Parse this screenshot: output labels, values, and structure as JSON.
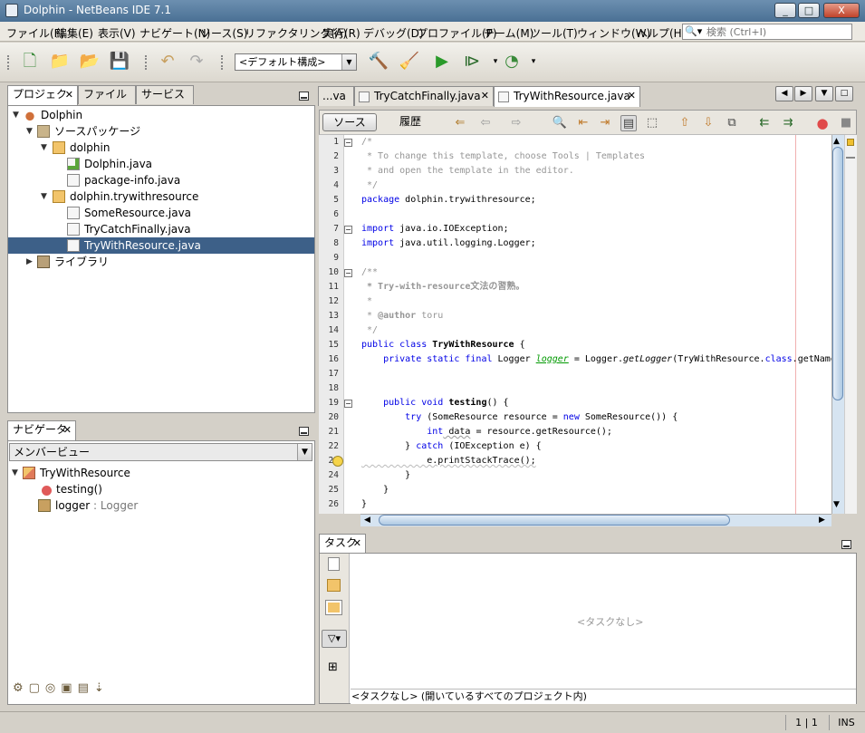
{
  "window": {
    "title": "Dolphin - NetBeans IDE 7.1",
    "buttons": [
      "_",
      "□",
      "X"
    ]
  },
  "menubar": {
    "items": [
      "ファイル(F)",
      "編集(E)",
      "表示(V)",
      "ナビゲート(N)",
      "ソース(S)",
      "リファクタリング(A)",
      "実行(R)",
      "デバッグ(D)",
      "プロファイル(P)",
      "チーム(M)",
      "ツール(T)",
      "ウィンドウ(W)",
      "ヘルプ(H)"
    ],
    "search_placeholder": "検索 (Ctrl+I)"
  },
  "toolbar": {
    "config": "<デフォルト構成>"
  },
  "project_panel": {
    "tabs": [
      "プロジェクト",
      "ファイル",
      "サービス"
    ],
    "tree": [
      {
        "label": "Dolphin",
        "icon": "project-icon"
      },
      {
        "label": "ソースパッケージ",
        "icon": "source-folder-icon"
      },
      {
        "label": "dolphin",
        "icon": "package-icon"
      },
      {
        "label": "Dolphin.java",
        "icon": "main-java-file-icon"
      },
      {
        "label": "package-info.java",
        "icon": "java-file-icon"
      },
      {
        "label": "dolphin.trywithresource",
        "icon": "package-icon"
      },
      {
        "label": "SomeResource.java",
        "icon": "java-file-icon"
      },
      {
        "label": "TryCatchFinally.java",
        "icon": "java-file-icon"
      },
      {
        "label": "TryWithResource.java",
        "icon": "java-file-icon"
      },
      {
        "label": "ライブラリ",
        "icon": "library-icon"
      }
    ]
  },
  "navigator": {
    "tab": "ナビゲータ",
    "view": "メンバービュー",
    "class_name": "TryWithResource",
    "members": [
      {
        "name": "testing()",
        "type": ""
      },
      {
        "name": "logger",
        "type": " : Logger"
      }
    ]
  },
  "editor": {
    "tabs": [
      "...va",
      "TryCatchFinally.java",
      "TryWithResource.java"
    ],
    "source_tab": "ソース",
    "history_tab": "履歴",
    "line_numbers": [
      "1",
      "2",
      "3",
      "4",
      "5",
      "6",
      "7",
      "8",
      "9",
      "10",
      "11",
      "12",
      "13",
      "14",
      "15",
      "16",
      "17",
      "18",
      "19",
      "20",
      "21",
      "22",
      "23",
      "24",
      "25",
      "26"
    ],
    "code": {
      "l1": "/*",
      "l2": " * To change this template, choose Tools | Templates",
      "l3": " * and open the template in the editor.",
      "l4": " */",
      "l5a": "package",
      "l5b": " dolphin.trywithresource;",
      "l7a": "import",
      "l7b": " java.io.IOException;",
      "l8a": "import",
      "l8b": " java.util.logging.Logger;",
      "l10": "/**",
      "l11": " * Try-with-resource文法の習熟。",
      "l12": " *",
      "l13a": " * ",
      "l13b": "@author",
      "l13c": " toru",
      "l14": " */",
      "l15a": "public class",
      "l15b": " TryWithResource",
      "l15c": " {",
      "l16a": "    private static final",
      "l16b": " Logger ",
      "l16c": "logger",
      "l16d": " = Logger.",
      "l16e": "getLogger",
      "l16f": "(TryWithResource.",
      "l16g": "class",
      "l16h": ".getName",
      "l19a": "    public void",
      "l19b": " testing",
      "l19c": "() {",
      "l20a": "        try",
      "l20b": " (SomeResource resource = ",
      "l20c": "new",
      "l20d": " SomeResource()) {",
      "l21a": "            int",
      "l21b": " data",
      "l21c": " = resource.getResource();",
      "l22a": "        } ",
      "l22b": "catch",
      "l22c": " (IOException e) {",
      "l23": "            e.printStackTrace();",
      "l24": "        }",
      "l25": "    }",
      "l26": "}"
    }
  },
  "tasks": {
    "tab": "タスク",
    "empty": "<タスクなし>",
    "footer": "<タスクなし>  (開いているすべてのプロジェクト内)"
  },
  "statusbar": {
    "position": "1 | 1",
    "mode": "INS"
  }
}
